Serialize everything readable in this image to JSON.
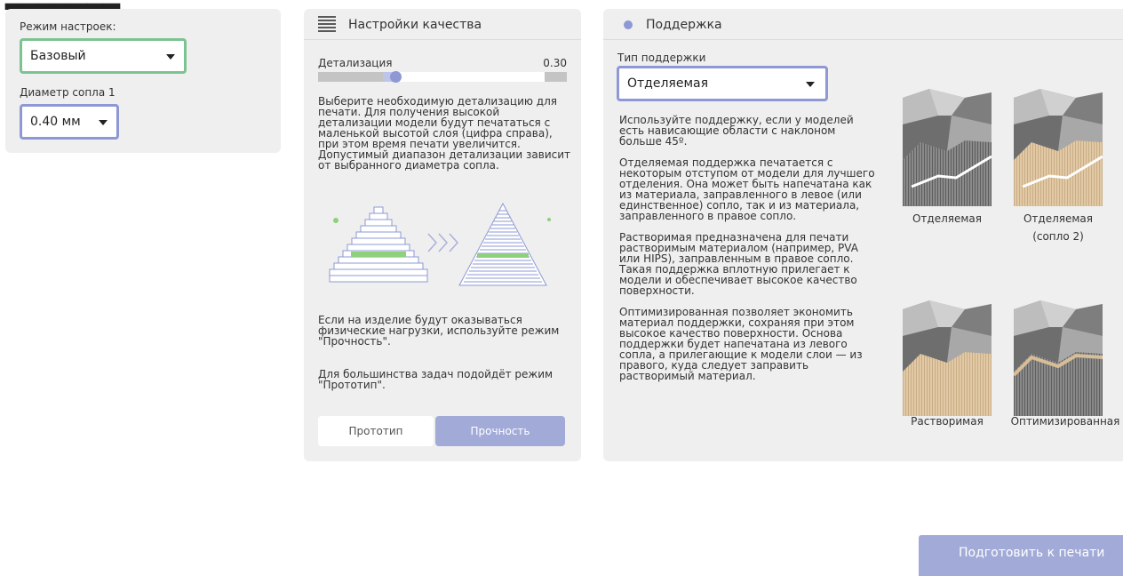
{
  "mode_panel": {
    "mode_label": "Режим настроек:",
    "mode_value": "Базовый",
    "nozzle_label": "Диаметр сопла 1",
    "nozzle_value": "0.40 мм"
  },
  "quality_panel": {
    "title": "Настройки качества",
    "detail_label": "Детализация",
    "detail_value": "0.30",
    "detail_slider_fraction": 0.31,
    "description": "Выберите необходимую детализацию для печати. Для получения высокой детализации модели будут печататься с маленькой высотой слоя (цифра справа), при этом время печати увеличится. Допустимый диапазон детализации зависит от выбранного диаметра сопла.",
    "load_hint": "Если на изделие будут оказываться физические нагрузки, используйте режим \"Прочность\".",
    "proto_hint": "Для большинства задач подойдёт режим \"Прототип\".",
    "buttons": {
      "prototype": "Прототип",
      "strength": "Прочность"
    }
  },
  "support_panel": {
    "title": "Поддержка",
    "type_label": "Тип поддержки",
    "type_value": "Отделяемая",
    "paragraphs": [
      "Используйте поддержку, если у моделей есть нависающие области с наклоном больше 45º.",
      "Отделяемая поддержка печатается с некоторым отступом от модели для лучшего отделения. Она может быть напечатана как из материала, заправленного в левое (или единственное) сопло, так и из материала, заправленного в правое сопло.",
      "Растворимая предназначена для печати растворимым материалом (например, PVA или HIPS), заправленным в правое сопло. Такая поддержка вплотную прилегает к модели и обеспечивает высокое качество поверхности.",
      "Оптимизированная позволяет экономить материал поддержки, сохраняя при этом высокое качество поверхности. Основа поддержки будет напечатана из левого сопла, а прилегающие к модели слои — из правого, куда следует заправить растворимый материал."
    ],
    "options": [
      {
        "label": "Отделяемая",
        "label2": ""
      },
      {
        "label": "Отделяемая",
        "label2": "(сопло 2)"
      },
      {
        "label": "Растворимая",
        "label2": ""
      },
      {
        "label": "Оптимизированная",
        "label2": ""
      }
    ]
  },
  "footer": {
    "prepare_label": "Подготовить к печати"
  },
  "colors": {
    "accent_blue": "#8e98d4",
    "accent_green": "#7cc392",
    "button_primary": "#a2aad8",
    "panel_bg": "#efefef",
    "support_beige": "#d7bd98",
    "support_dark": "#6a6a6a"
  }
}
